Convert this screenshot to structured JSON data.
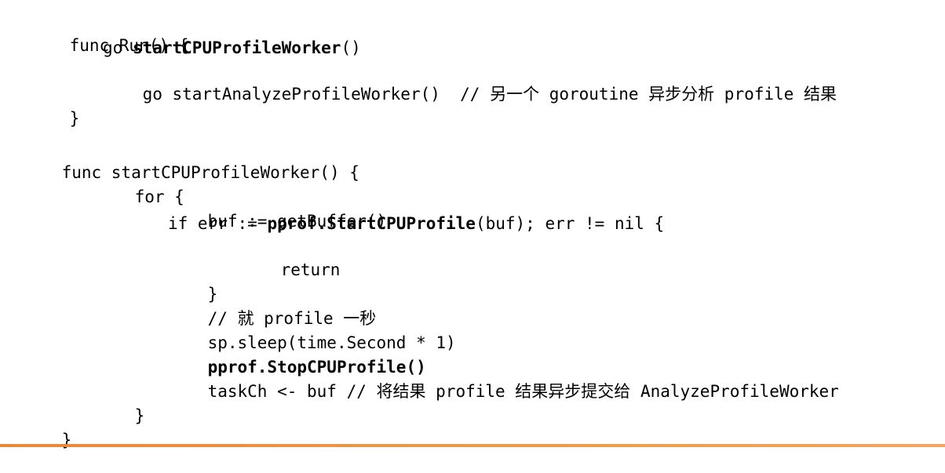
{
  "code": {
    "line1": "func Run() {",
    "line2_prefix": "go ",
    "line2_bold": "startCPUProfileWorker",
    "line2_suffix": "()",
    "line3": "go startAnalyzeProfileWorker()  // 另一个 goroutine 异步分析 profile 结果",
    "line4": "}",
    "line5": "func startCPUProfileWorker() {",
    "line6": "for {",
    "line7": "buf := getBuffer()",
    "line8_prefix": "if err := ",
    "line8_bold": "pprof.StartCPUProfile",
    "line8_suffix": "(buf); err != nil {",
    "line9": "return",
    "line10": "}",
    "line11": "// 就 profile 一秒",
    "line12": "sp.sleep(time.Second * 1)",
    "line13_bold": "pprof.StopCPUProfile()",
    "line14": "taskCh <- buf // 将结果 profile 结果异步提交给 AnalyzeProfileWorker",
    "line15": "}",
    "line16": "}"
  },
  "accent_color": "#e8893a"
}
